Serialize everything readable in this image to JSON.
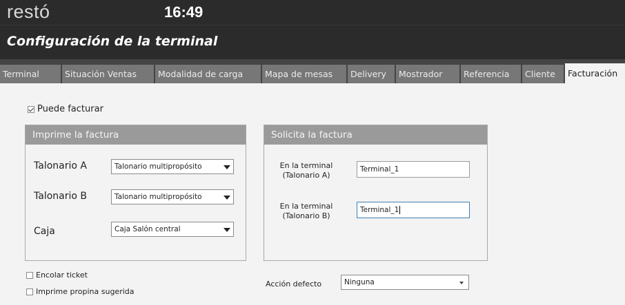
{
  "app": {
    "brand": "restó",
    "clock": "16:49"
  },
  "page_title": "Configuración de la terminal",
  "tabs": [
    {
      "label": "Terminal",
      "active": false
    },
    {
      "label": "Situación Ventas",
      "active": false
    },
    {
      "label": "Modalidad de carga",
      "active": false
    },
    {
      "label": "Mapa de mesas",
      "active": false
    },
    {
      "label": "Delivery",
      "active": false
    },
    {
      "label": "Mostrador",
      "active": false
    },
    {
      "label": "Referencia",
      "active": false
    },
    {
      "label": "Cliente",
      "active": false
    },
    {
      "label": "Facturación",
      "active": true
    }
  ],
  "puede_facturar": {
    "label": "Puede facturar",
    "checked": true
  },
  "imprime_panel": {
    "title": "Imprime la factura",
    "talonario_a": {
      "label": "Talonario A",
      "value": "Talonario multipropósito"
    },
    "talonario_b": {
      "label": "Talonario B",
      "value": "Talonario multipropósito"
    },
    "caja": {
      "label": "Caja",
      "value": "Caja Salón central"
    }
  },
  "solicita_panel": {
    "title": "Solicita la factura",
    "terminal_a": {
      "label_line1": "En la terminal",
      "label_line2": "(Talonario A)",
      "value": "Terminal_1"
    },
    "terminal_b": {
      "label_line1": "En la terminal",
      "label_line2": "(Talonario B)",
      "value": "Terminal_1"
    }
  },
  "encolar_ticket": {
    "label": "Encolar ticket",
    "checked": false
  },
  "imprime_propina": {
    "label": "Imprime propina sugerida",
    "checked": false
  },
  "accion_defecto": {
    "label": "Acción defecto",
    "value": "Ninguna"
  }
}
